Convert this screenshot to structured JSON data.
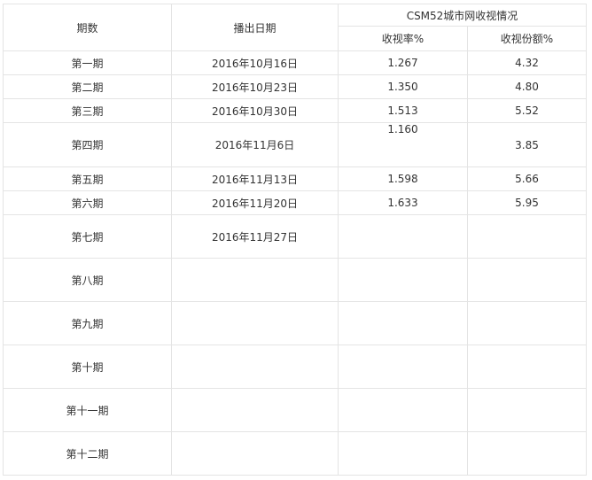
{
  "header": {
    "episode": "期数",
    "air_date": "播出日期",
    "group": "CSM52城市网收视情况",
    "rating": "收视率%",
    "share": "收视份额%"
  },
  "rows": [
    {
      "episode": "第一期",
      "date": "2016年10月16日",
      "rating": "1.267",
      "share": "4.32"
    },
    {
      "episode": "第二期",
      "date": "2016年10月23日",
      "rating": "1.350",
      "share": "4.80"
    },
    {
      "episode": "第三期",
      "date": "2016年10月30日",
      "rating": "1.513",
      "share": "5.52"
    },
    {
      "episode": "第四期",
      "date": "2016年11月6日",
      "rating": "1.160",
      "share": "3.85"
    },
    {
      "episode": "第五期",
      "date": "2016年11月13日",
      "rating": "1.598",
      "share": "5.66"
    },
    {
      "episode": "第六期",
      "date": "2016年11月20日",
      "rating": "1.633",
      "share": "5.95"
    },
    {
      "episode": "第七期",
      "date": "2016年11月27日",
      "rating": "",
      "share": ""
    },
    {
      "episode": "第八期",
      "date": "",
      "rating": "",
      "share": ""
    },
    {
      "episode": "第九期",
      "date": "",
      "rating": "",
      "share": ""
    },
    {
      "episode": "第十期",
      "date": "",
      "rating": "",
      "share": ""
    },
    {
      "episode": "第十一期",
      "date": "",
      "rating": "",
      "share": ""
    },
    {
      "episode": "第十二期",
      "date": "",
      "rating": "",
      "share": ""
    }
  ]
}
